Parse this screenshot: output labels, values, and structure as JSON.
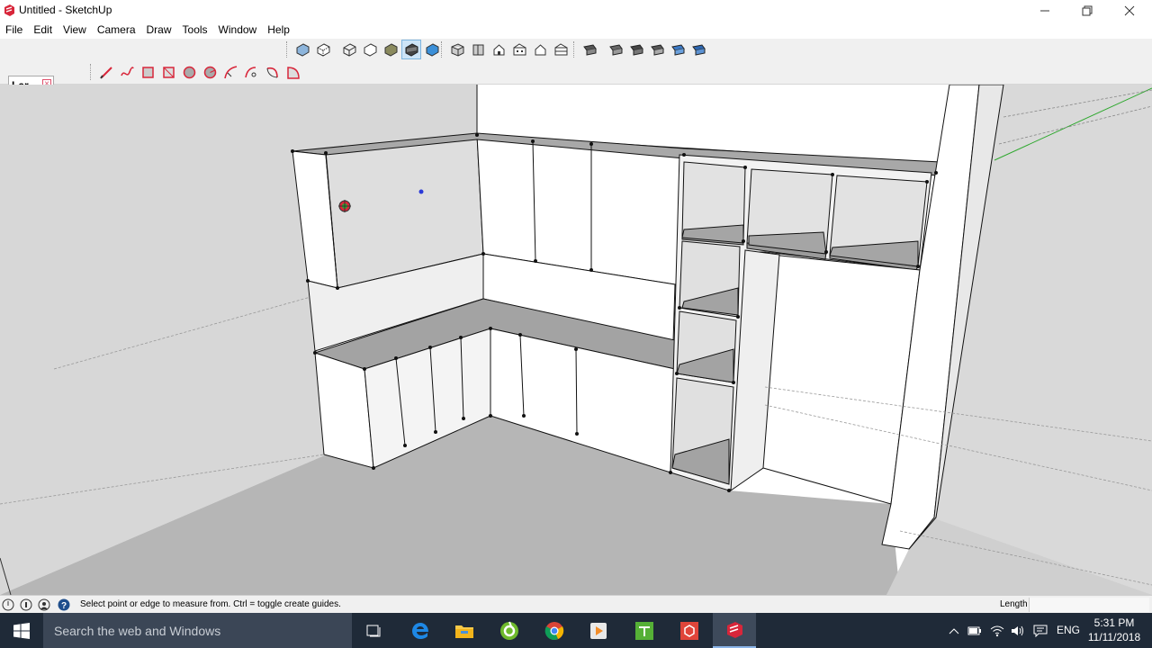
{
  "window": {
    "title": "Untitled - SketchUp"
  },
  "menubar": {
    "items": [
      "File",
      "Edit",
      "View",
      "Camera",
      "Draw",
      "Tools",
      "Window",
      "Help"
    ]
  },
  "toolbars": {
    "views": [
      "iso-view-icon",
      "top-view-icon",
      "front-view-icon",
      "right-view-icon",
      "back-view-icon",
      "left-view-icon",
      "bottom-view-icon"
    ],
    "styles": [
      "xray-icon",
      "back-edges-icon",
      "wireframe-icon",
      "hidden-line-icon",
      "shaded-icon",
      "shaded-textures-icon",
      "monochrome-icon"
    ],
    "draw": [
      "line-icon",
      "freehand-icon",
      "rectangle-icon",
      "rotated-rectangle-icon",
      "circle-icon",
      "polygon-icon",
      "arc-icon",
      "two-point-arc-icon",
      "three-point-arc-icon",
      "pie-icon"
    ]
  },
  "palette": {
    "title": "Lar...",
    "close_symbol": "×"
  },
  "statusbar": {
    "message": "Select point or edge to measure from.  Ctrl = toggle create guides.",
    "measurement_label": "Length",
    "measurement_value": ""
  },
  "taskbar": {
    "search_placeholder": "Search the web and Windows",
    "language": "ENG",
    "time": "5:31 PM",
    "date": "11/11/2018"
  },
  "colors": {
    "taskbar_bg": "#1f2a38",
    "sky": "#ffffff",
    "ground": "#d9d9d9",
    "shelf_gray": "#a0a0a0",
    "axis_green": "#2ea82e",
    "accent_red": "#d8263a"
  }
}
